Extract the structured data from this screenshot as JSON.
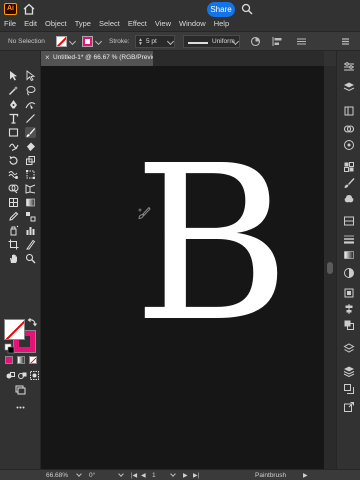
{
  "app": {
    "logo_text": "Ai",
    "share_label": "Share"
  },
  "menubar": {
    "items": [
      "File",
      "Edit",
      "Object",
      "Type",
      "Select",
      "Effect",
      "View",
      "Window",
      "Help"
    ]
  },
  "controlbar": {
    "selection_label": "No Selection",
    "stroke_label": "Stroke:",
    "stroke_weight": "5 pt",
    "brush_profile": "Uniform",
    "fill_color": "none",
    "stroke_color": "#e6127a"
  },
  "document": {
    "tab_title": "Untitled-1* @ 66.67 % (RGB/Preview)",
    "close_glyph": "×",
    "artwork_text": "B",
    "canvas_color": "#161617"
  },
  "statusbar": {
    "zoom": "66.68%",
    "rotation": "0°",
    "artboard_number": "1",
    "current_tool": "Paintbrush"
  },
  "colors": {
    "accent": "#1473e6",
    "stroke_magenta": "#e6127a",
    "logo_orange": "#ff9a00"
  },
  "icons": {
    "toolbar": [
      "selection-tool-icon",
      "direct-selection-tool-icon",
      "magic-wand-icon",
      "lasso-icon",
      "pen-tool-icon",
      "curvature-icon",
      "type-tool-icon",
      "line-tool-icon",
      "rectangle-tool-icon",
      "paintbrush-icon",
      "shaper-icon",
      "eraser-icon",
      "rotate-icon",
      "scale-icon",
      "warp-icon",
      "free-transform-icon",
      "shape-builder-icon",
      "perspective-icon",
      "mesh-icon",
      "gradient-icon",
      "eyedropper-icon",
      "blend-icon",
      "symbol-sprayer-icon",
      "graph-icon",
      "artboard-icon",
      "slice-icon",
      "hand-icon",
      "zoom-icon"
    ],
    "right_panel": [
      "properties-icon",
      "layers-icon",
      "libraries-icon",
      "cc-icon",
      "color-icon",
      "swatches-icon",
      "brushes-icon",
      "symbols-icon",
      "graphic-styles-icon",
      "stroke-icon",
      "gradient-panel-icon",
      "transparency-icon",
      "appearance-icon",
      "align-icon",
      "pathfinder-icon",
      "transform-icon",
      "stack-icon",
      "links-icon",
      "export-icon"
    ]
  }
}
